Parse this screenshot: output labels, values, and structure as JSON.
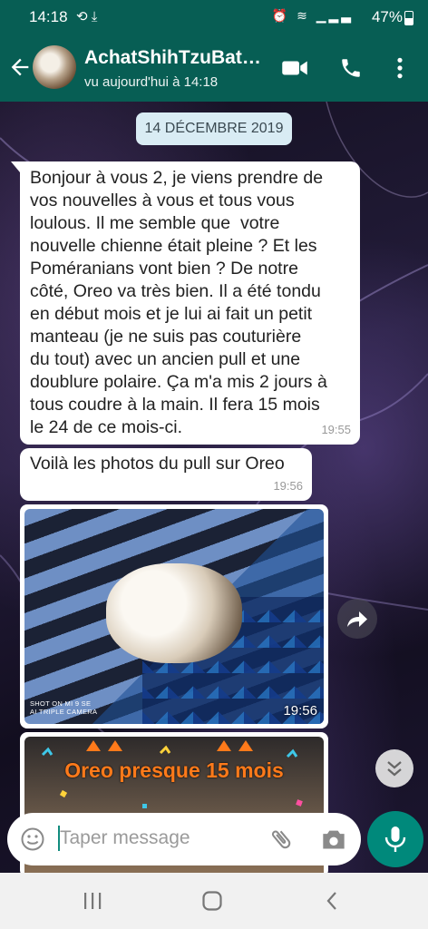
{
  "status_bar": {
    "time": "14:18",
    "battery": "47%",
    "left_icons": "⟲ ⤓",
    "right_icons": "⏰ ≋ ▁▂▃"
  },
  "header": {
    "contact_name": "AchatShihTzuBat…",
    "last_seen": "vu aujourd'hui à 14:18",
    "back_icon": "arrow-left-icon",
    "video_icon": "video-call-icon",
    "call_icon": "phone-icon",
    "menu_icon": "more-vertical-icon"
  },
  "chat": {
    "date_chip": "14 DÉCEMBRE 2019",
    "messages": [
      {
        "lines": [
          "Bonjour à vous 2, je viens prendre de",
          "vos nouvelles à vous et tous vous",
          "loulous. Il me semble que  votre",
          "nouvelle chienne était pleine ? Et les",
          "Poméranians vont bien ? De notre",
          "côté, Oreo va très bien. Il a été tondu",
          "en début mois et je lui ai fait un petit",
          "manteau (je ne suis pas couturière",
          "du tout) avec un ancien pull et une",
          "doublure polaire. Ça m'a mis 2 jours à",
          "tous coudre à la main. Il fera 15 mois",
          "le 24 de ce mois-ci."
        ],
        "time": "19:55"
      },
      {
        "lines": [
          "Voilà les photos du pull sur Oreo"
        ],
        "time": "19:56"
      }
    ],
    "photo1": {
      "watermark_line1": "SHOT ON MI 9 SE",
      "watermark_line2": "AI TRIPLE CAMERA",
      "time": "19:56"
    },
    "photo2": {
      "banner": "Oreo presque 15 mois"
    }
  },
  "composer": {
    "placeholder": "Taper message",
    "emoji_icon": "emoji-icon",
    "attach_icon": "paperclip-icon",
    "camera_icon": "camera-icon",
    "mic_icon": "microphone-icon"
  },
  "colors": {
    "header": "#075E54",
    "accent": "#00897B",
    "bubble": "#ffffff",
    "date_chip": "#d9ecf4",
    "banner_text": "#ff7a1a"
  }
}
